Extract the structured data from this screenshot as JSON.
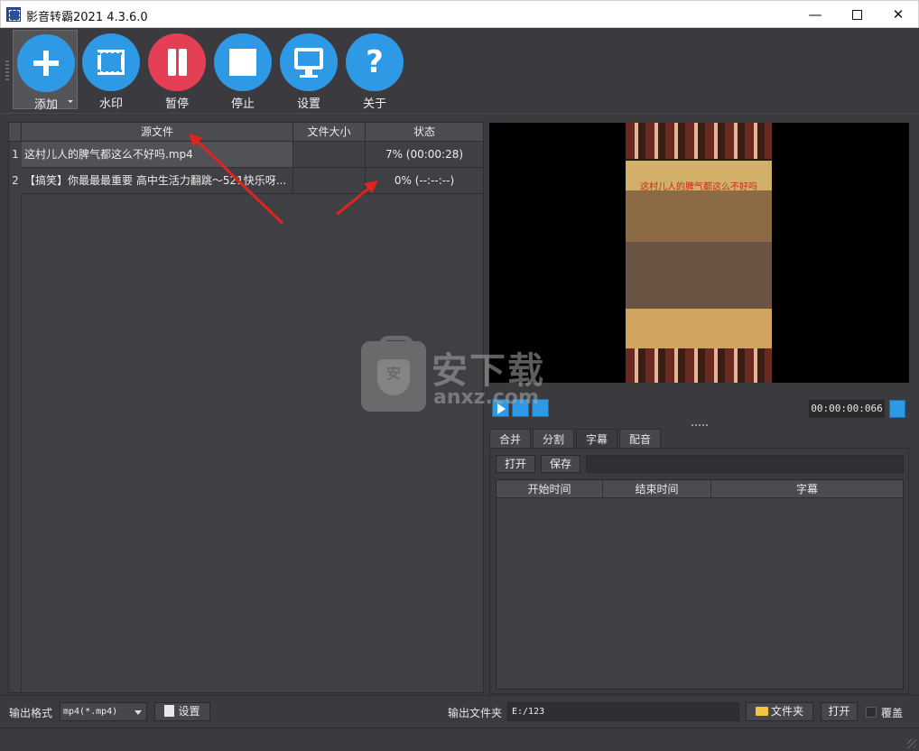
{
  "window": {
    "title": "影音转霸2021 4.3.6.0",
    "minimize": "—",
    "close": "✕"
  },
  "toolbar": {
    "buttons": [
      {
        "label": "添加",
        "icon": "plus-icon"
      },
      {
        "label": "水印",
        "icon": "film-icon"
      },
      {
        "label": "暂停",
        "icon": "pause-icon"
      },
      {
        "label": "停止",
        "icon": "stop-icon"
      },
      {
        "label": "设置",
        "icon": "monitor-icon"
      },
      {
        "label": "关于",
        "icon": "question-icon",
        "glyph": "?"
      }
    ]
  },
  "file_table": {
    "columns": [
      "源文件",
      "文件大小",
      "状态"
    ],
    "rows": [
      {
        "num": "1",
        "source": "这村儿人的脾气都这么不好吗.mp4",
        "size": "",
        "status": "7% (00:00:28)"
      },
      {
        "num": "2",
        "source": "【搞笑】你最最最重要 高中生活力翻跳～521快乐呀...",
        "size": "",
        "status": "0% (--:--:--)"
      }
    ]
  },
  "preview": {
    "caption": "这村儿人的脾气都这么不好吗",
    "time": "00:00:00:066"
  },
  "tabs": [
    "合并",
    "分割",
    "字幕",
    "配音"
  ],
  "subtitle": {
    "open": "打开",
    "save": "保存",
    "path": "",
    "columns": [
      "开始时间",
      "结束时间",
      "字幕"
    ]
  },
  "watermark": {
    "big": "安下载",
    "small": "anxz.com",
    "shield": "安"
  },
  "bottom": {
    "format_label": "输出格式",
    "format_value": "mp4(*.mp4)",
    "settings_label": "设置",
    "output_label": "输出文件夹",
    "output_path": "E:/123",
    "folder_label": "文件夹",
    "open_label": "打开",
    "overwrite_label": "覆盖"
  },
  "colors": {
    "accent": "#2e9ae5",
    "pause": "#e43f55",
    "annotation": "#e0241c",
    "background": "#3b3b3f"
  }
}
